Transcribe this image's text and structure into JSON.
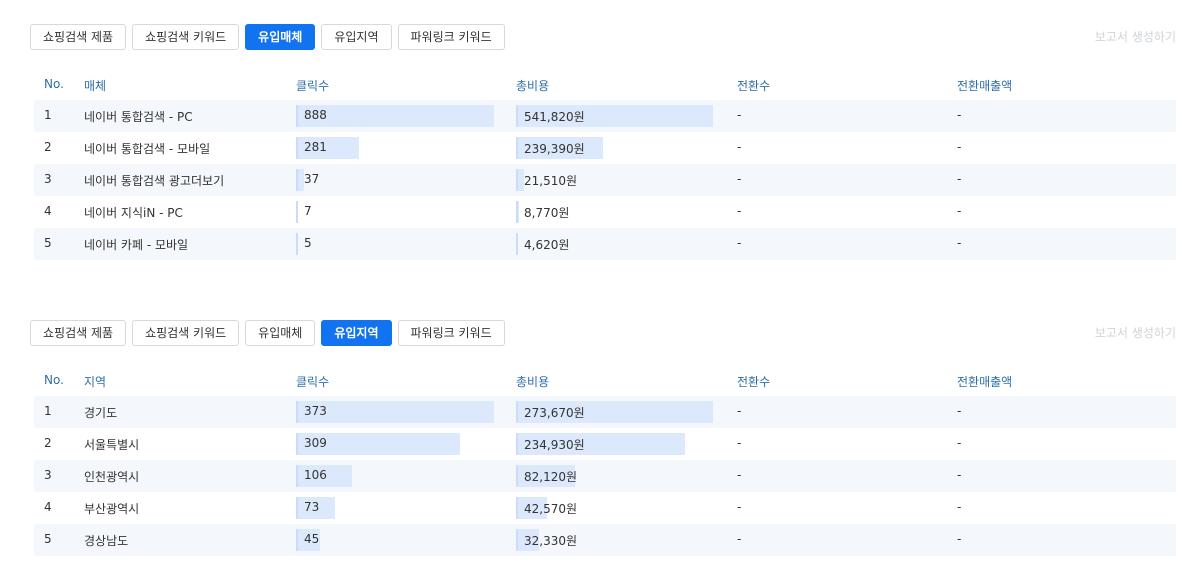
{
  "sections": [
    {
      "tabs": [
        {
          "label": "쇼핑검색 제품",
          "active": false
        },
        {
          "label": "쇼핑검색 키워드",
          "active": false
        },
        {
          "label": "유입매체",
          "active": true
        },
        {
          "label": "유입지역",
          "active": false
        },
        {
          "label": "파워링크 키워드",
          "active": false
        }
      ],
      "report_link": "보고서 생성하기",
      "headers": {
        "no": "No.",
        "name": "매체",
        "clicks": "클릭수",
        "cost": "총비용",
        "conversions": "전환수",
        "revenue": "전환매출액"
      },
      "rows": [
        {
          "no": "1",
          "name": "네이버 통합검색 - PC",
          "clicks": "888",
          "clicks_value": 888,
          "cost": "541,820원",
          "cost_value": 541820,
          "conversions": "-",
          "revenue": "-"
        },
        {
          "no": "2",
          "name": "네이버 통합검색 - 모바일",
          "clicks": "281",
          "clicks_value": 281,
          "cost": "239,390원",
          "cost_value": 239390,
          "conversions": "-",
          "revenue": "-"
        },
        {
          "no": "3",
          "name": "네이버 통합검색 광고더보기",
          "clicks": "37",
          "clicks_value": 37,
          "cost": "21,510원",
          "cost_value": 21510,
          "conversions": "-",
          "revenue": "-"
        },
        {
          "no": "4",
          "name": "네이버 지식iN - PC",
          "clicks": "7",
          "clicks_value": 7,
          "cost": "8,770원",
          "cost_value": 8770,
          "conversions": "-",
          "revenue": "-"
        },
        {
          "no": "5",
          "name": "네이버 카페 - 모바일",
          "clicks": "5",
          "clicks_value": 5,
          "cost": "4,620원",
          "cost_value": 4620,
          "conversions": "-",
          "revenue": "-"
        }
      ]
    },
    {
      "tabs": [
        {
          "label": "쇼핑검색 제품",
          "active": false
        },
        {
          "label": "쇼핑검색 키워드",
          "active": false
        },
        {
          "label": "유입매체",
          "active": false
        },
        {
          "label": "유입지역",
          "active": true
        },
        {
          "label": "파워링크 키워드",
          "active": false
        }
      ],
      "report_link": "보고서 생성하기",
      "headers": {
        "no": "No.",
        "name": "지역",
        "clicks": "클릭수",
        "cost": "총비용",
        "conversions": "전환수",
        "revenue": "전환매출액"
      },
      "rows": [
        {
          "no": "1",
          "name": "경기도",
          "clicks": "373",
          "clicks_value": 373,
          "cost": "273,670원",
          "cost_value": 273670,
          "conversions": "-",
          "revenue": "-"
        },
        {
          "no": "2",
          "name": "서울특별시",
          "clicks": "309",
          "clicks_value": 309,
          "cost": "234,930원",
          "cost_value": 234930,
          "conversions": "-",
          "revenue": "-"
        },
        {
          "no": "3",
          "name": "인천광역시",
          "clicks": "106",
          "clicks_value": 106,
          "cost": "82,120원",
          "cost_value": 82120,
          "conversions": "-",
          "revenue": "-"
        },
        {
          "no": "4",
          "name": "부산광역시",
          "clicks": "73",
          "clicks_value": 73,
          "cost": "42,570원",
          "cost_value": 42570,
          "conversions": "-",
          "revenue": "-"
        },
        {
          "no": "5",
          "name": "경상남도",
          "clicks": "45",
          "clicks_value": 45,
          "cost": "32,330원",
          "cost_value": 32330,
          "conversions": "-",
          "revenue": "-"
        }
      ]
    }
  ]
}
